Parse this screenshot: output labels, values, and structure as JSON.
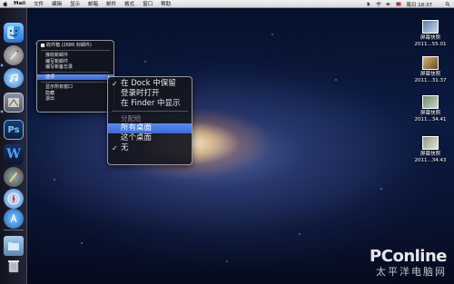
{
  "menubar": {
    "app": "Mail",
    "items": [
      "文件",
      "编辑",
      "显示",
      "邮箱",
      "邮件",
      "格式",
      "窗口",
      "帮助"
    ],
    "clock": "周日 18:37"
  },
  "dock_menu": {
    "items": [
      {
        "label": "收件箱 (2686 封邮件)",
        "type": "item",
        "check": true
      },
      {
        "type": "sep"
      },
      {
        "label": "接收新邮件",
        "type": "item"
      },
      {
        "label": "编写新邮件",
        "type": "item"
      },
      {
        "label": "编写新备忘录",
        "type": "item"
      },
      {
        "type": "sep"
      },
      {
        "label": "选项",
        "type": "item",
        "highlight": true,
        "submenu": true
      },
      {
        "type": "sep"
      },
      {
        "label": "显示所有窗口",
        "type": "item"
      },
      {
        "label": "隐藏",
        "type": "item"
      },
      {
        "label": "退出",
        "type": "item"
      }
    ]
  },
  "options_submenu": {
    "items": [
      {
        "label": "在 Dock 中保留",
        "check": true
      },
      {
        "label": "登录时打开"
      },
      {
        "label": "在 Finder 中显示"
      },
      {
        "type": "sep"
      },
      {
        "label": "分配给",
        "disabled": true
      },
      {
        "label": "所有桌面",
        "highlight": true
      },
      {
        "label": "这个桌面"
      },
      {
        "label": "无",
        "check": true
      }
    ]
  },
  "desktop_files": [
    {
      "line1": "屏幕快照",
      "line2": "2011...55.01"
    },
    {
      "line1": "屏幕快照",
      "line2": "2011...31.37"
    },
    {
      "line1": "屏幕快照",
      "line2": "2011...34.41"
    },
    {
      "line1": "屏幕快照",
      "line2": "2011...34.43"
    }
  ],
  "watermark": {
    "logo_main": "PConline",
    "logo_sub": "太平洋电脑网"
  },
  "colors": {
    "highlight": "#3b6ad8",
    "menu_bg": "#14161e"
  }
}
